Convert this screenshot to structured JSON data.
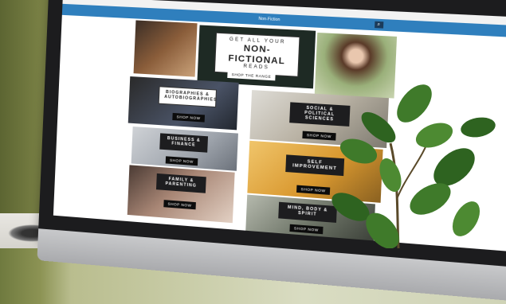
{
  "site": {
    "topbar_items": [
      "",
      "",
      "",
      ""
    ],
    "nav_label": "Non-Fiction"
  },
  "hero": {
    "line1": "GET ALL YOUR",
    "line2": "NON-FICTIONAL",
    "line3": "READS",
    "button": "SHOP THE RANGE"
  },
  "categories": [
    {
      "label": "BIOGRAPHIES & AUTOBIOGRAPHIES",
      "button": "SHOP NOW"
    },
    {
      "label": "SOCIAL & POLITICAL SCIENCES",
      "button": "SHOP NOW"
    },
    {
      "label": "BUSINESS & FINANCE",
      "button": "SHOP NOW"
    },
    {
      "label": "SELF IMPROVEMENT",
      "button": "SHOP NOW"
    },
    {
      "label": "FAMILY & PARENTING",
      "button": "SHOP NOW"
    },
    {
      "label": "MIND, BODY & SPIRIT",
      "button": "SHOP NOW"
    }
  ],
  "colors": {
    "nav": "#2f7fbd",
    "label_bg": "#1d1d1f",
    "plant": "#3f7a2a"
  },
  "icons": {
    "search": "search-icon"
  }
}
